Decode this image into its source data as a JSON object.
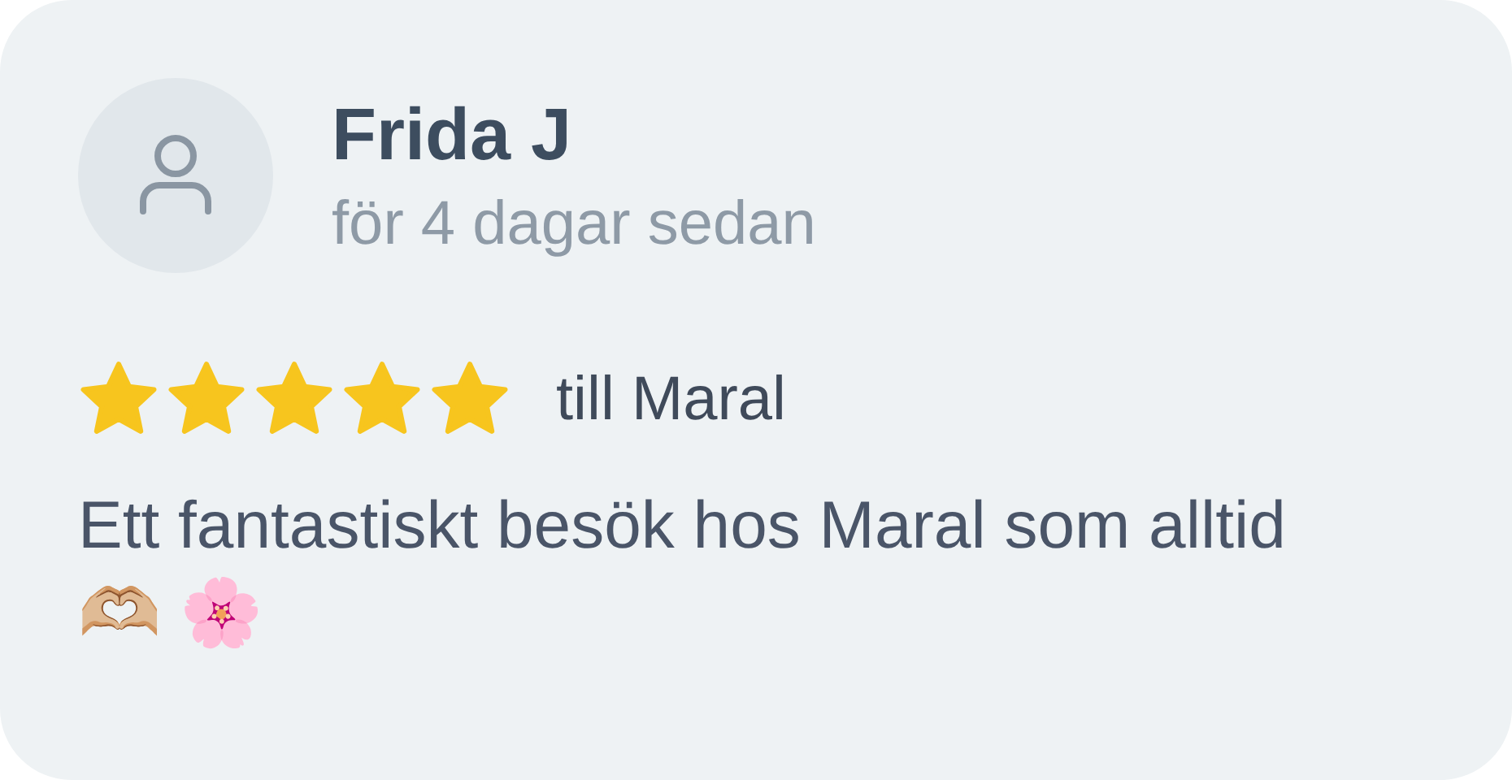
{
  "review": {
    "author": "Frida J",
    "time": "för 4 dagar sedan",
    "stars": 5,
    "recipient": "till Maral",
    "text": "Ett fantastiskt besök hos Maral som alltid 🫶🏼 🌸"
  }
}
